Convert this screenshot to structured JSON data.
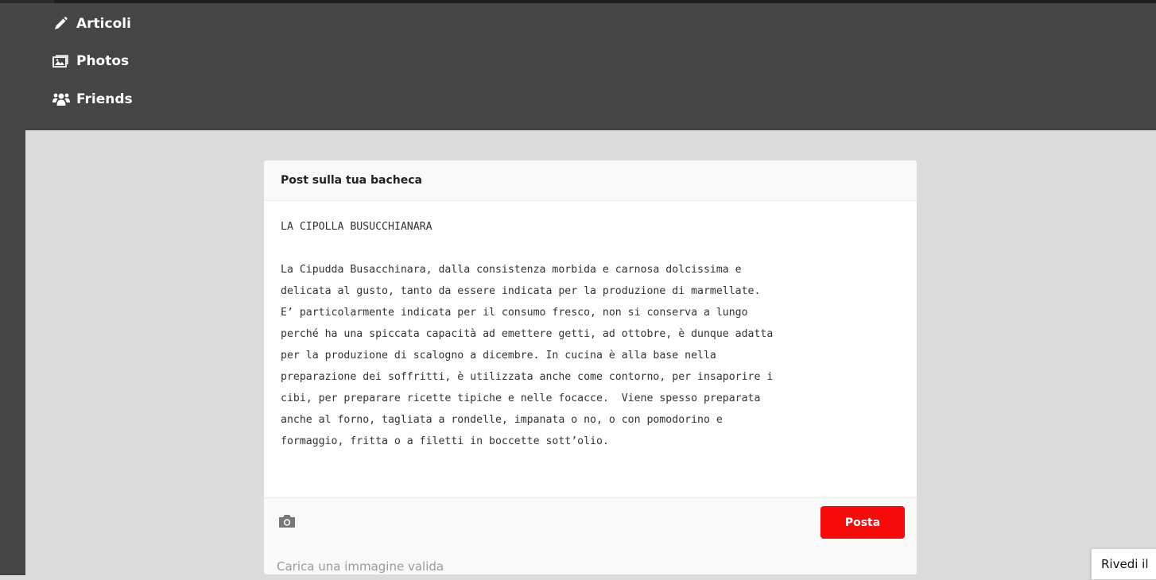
{
  "menu": {
    "items": [
      {
        "label": "Articoli",
        "icon": "pencil-icon"
      },
      {
        "label": "Photos",
        "icon": "photo-icon"
      },
      {
        "label": "Friends",
        "icon": "friends-icon"
      }
    ]
  },
  "post": {
    "header": "Post sulla tua bacheca",
    "text": "LA CIPOLLA BUSUCCHIANARA\n\nLa Cipudda Busacchinara, dalla consistenza morbida e carnosa dolcissima e\ndelicata al gusto, tanto da essere indicata per la produzione di marmellate.\nE’ particolarmente indicata per il consumo fresco, non si conserva a lungo\nperché ha una spiccata capacità ad emettere getti, ad ottobre, è dunque adatta\nper la produzione di scalogno a dicembre. In cucina è alla base nella\npreparazione dei soffritti, è utilizzata anche come contorno, per insaporire i\ncibi, per preparare ricette tipiche e nelle focacce.  Viene spesso preparata\nanche al forno, tagliata a rondelle, impanata o no, o con pomodorino e\nformaggio, fritta o a filetti in boccette sott’olio.",
    "camera_icon": "camera-icon",
    "submit_label": "Posta",
    "hint": "Carica una immagine valida"
  },
  "tooltip": {
    "text": "Rivedi il"
  },
  "colors": {
    "menu_bg": "#454545",
    "page_bg": "#dcdcdc",
    "accent": "#f60a0a"
  }
}
